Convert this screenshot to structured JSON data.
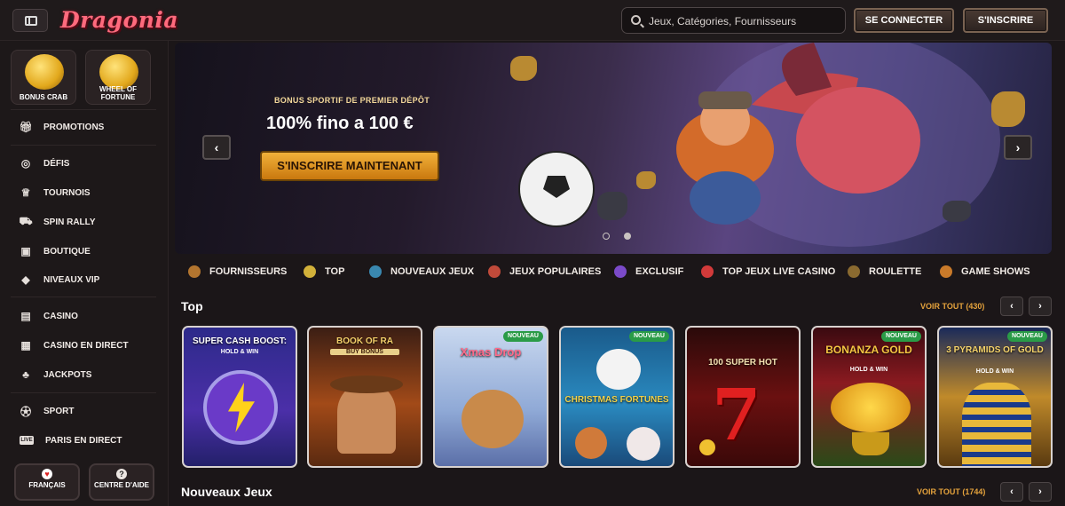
{
  "header": {
    "logo": "Dragonia",
    "search_placeholder": "Jeux, Catégories, Fournisseurs",
    "login_label": "SE CONNECTER",
    "register_label": "S'INSCRIRE"
  },
  "sidebar": {
    "promos": [
      {
        "label": "BONUS CRAB"
      },
      {
        "label": "WHEEL OF FORTUNE"
      }
    ],
    "items": [
      {
        "label": "PROMOTIONS",
        "icon": "gift-icon"
      },
      {
        "label": "DÉFIS",
        "icon": "target-icon"
      },
      {
        "label": "TOURNOIS",
        "icon": "trophy-icon"
      },
      {
        "label": "SPIN RALLY",
        "icon": "car-icon"
      },
      {
        "label": "BOUTIQUE",
        "icon": "bag-icon"
      },
      {
        "label": "NIVEAUX VIP",
        "icon": "diamond-icon"
      },
      {
        "label": "CASINO",
        "icon": "slot-machine-icon"
      },
      {
        "label": "CASINO EN DIRECT",
        "icon": "cards-icon"
      },
      {
        "label": "JACKPOTS",
        "icon": "clover-icon"
      },
      {
        "label": "SPORT",
        "icon": "ball-icon"
      },
      {
        "label": "PARIS EN DIRECT",
        "icon": "live-icon"
      }
    ],
    "language_label": "FRANÇAIS",
    "help_label": "CENTRE D'AIDE"
  },
  "hero": {
    "bonus_text": "BONUS SPORTIF DE PREMIER DÉPÔT",
    "title": "100% fino a 100 €",
    "cta_label": "S'INSCRIRE MAINTENANT"
  },
  "categories": [
    {
      "label": "FOURNISSEURS",
      "color": "#b3752f"
    },
    {
      "label": "TOP",
      "color": "#d2b13a"
    },
    {
      "label": "NOUVEAUX JEUX",
      "color": "#3a88b0"
    },
    {
      "label": "JEUX POPULAIRES",
      "color": "#c04a3a"
    },
    {
      "label": "EXCLUSIF",
      "color": "#7b4ac9"
    },
    {
      "label": "TOP JEUX LIVE CASINO",
      "color": "#d23a3a"
    },
    {
      "label": "ROULETTE",
      "color": "#8a6a30"
    },
    {
      "label": "GAME SHOWS",
      "color": "#c97a2a"
    }
  ],
  "top_section": {
    "title": "Top",
    "see_all": "VOIR TOUT (430)",
    "games": [
      {
        "title": "SUPER CASH BOOST:",
        "subtitle": "HOLD & WIN",
        "badge": ""
      },
      {
        "title": "BOOK OF RA",
        "subtitle": "BUY BONUS",
        "badge": ""
      },
      {
        "title": "Xmas Drop",
        "subtitle": "",
        "badge": "NOUVEAU"
      },
      {
        "title": "CHRISTMAS FORTUNES",
        "subtitle": "",
        "badge": "NOUVEAU"
      },
      {
        "title": "100 SUPER HOT",
        "subtitle": "",
        "badge": ""
      },
      {
        "title": "BONANZA GOLD",
        "subtitle": "HOLD & WIN",
        "badge": "NOUVEAU"
      },
      {
        "title": "3 PYRAMIDS OF GOLD",
        "subtitle": "HOLD & WIN",
        "badge": "NOUVEAU"
      }
    ]
  },
  "new_section": {
    "title": "Nouveaux Jeux",
    "see_all": "VOIR TOUT (1744)"
  }
}
